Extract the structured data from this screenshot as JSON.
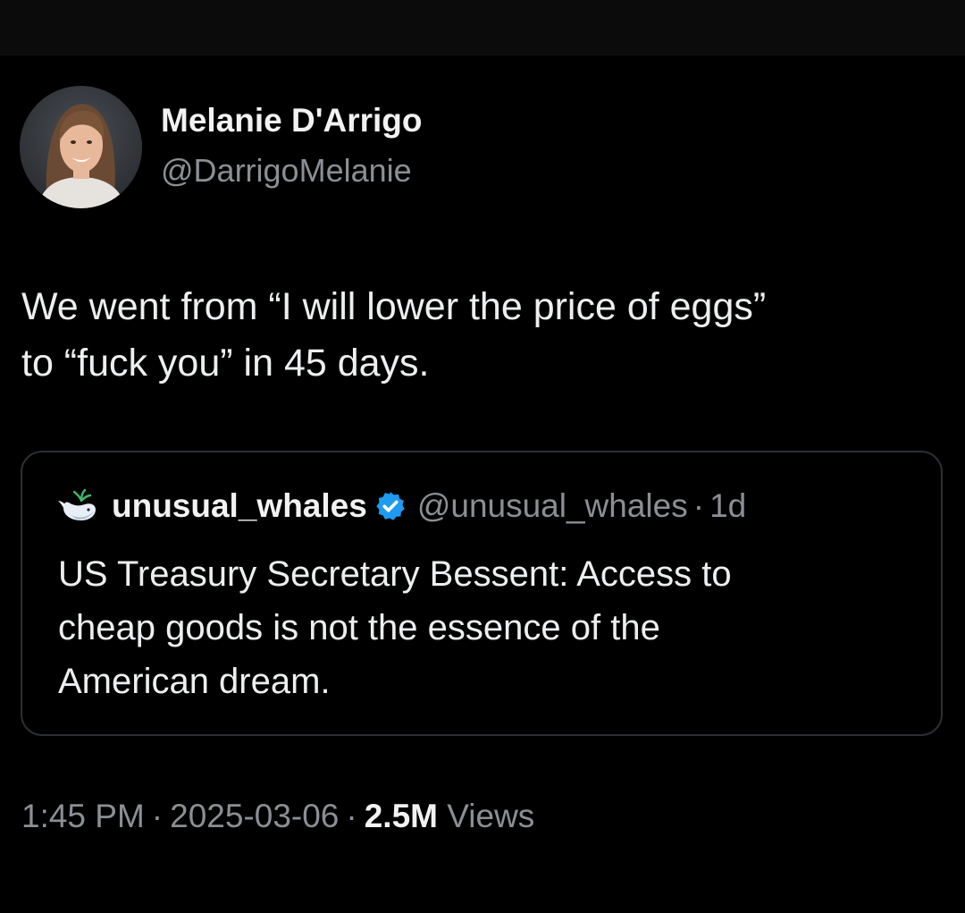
{
  "author": {
    "display_name": "Melanie D'Arrigo",
    "handle": "@DarrigoMelanie"
  },
  "tweet": {
    "text_lines": [
      "We went from “I will lower the price of eggs”",
      "to “fuck you” in 45 days."
    ]
  },
  "quoted_tweet": {
    "display_name": "unusual_whales",
    "verified_icon": "verified-badge-icon",
    "handle": "@unusual_whales",
    "dot": "·",
    "time": "1d",
    "text_lines": [
      "US Treasury Secretary Bessent: Access to",
      "cheap goods is not the essence of the",
      "American dream."
    ]
  },
  "meta": {
    "time": "1:45 PM",
    "sep1": "·",
    "date": "2025-03-06",
    "sep2": "·",
    "views_count": "2.5M",
    "views_label": "Views"
  },
  "colors": {
    "background": "#000000",
    "text_primary": "#eceeef",
    "text_secondary": "#8b8f94",
    "card_border": "#2c2f33",
    "verified_blue": "#1d9bf0"
  }
}
